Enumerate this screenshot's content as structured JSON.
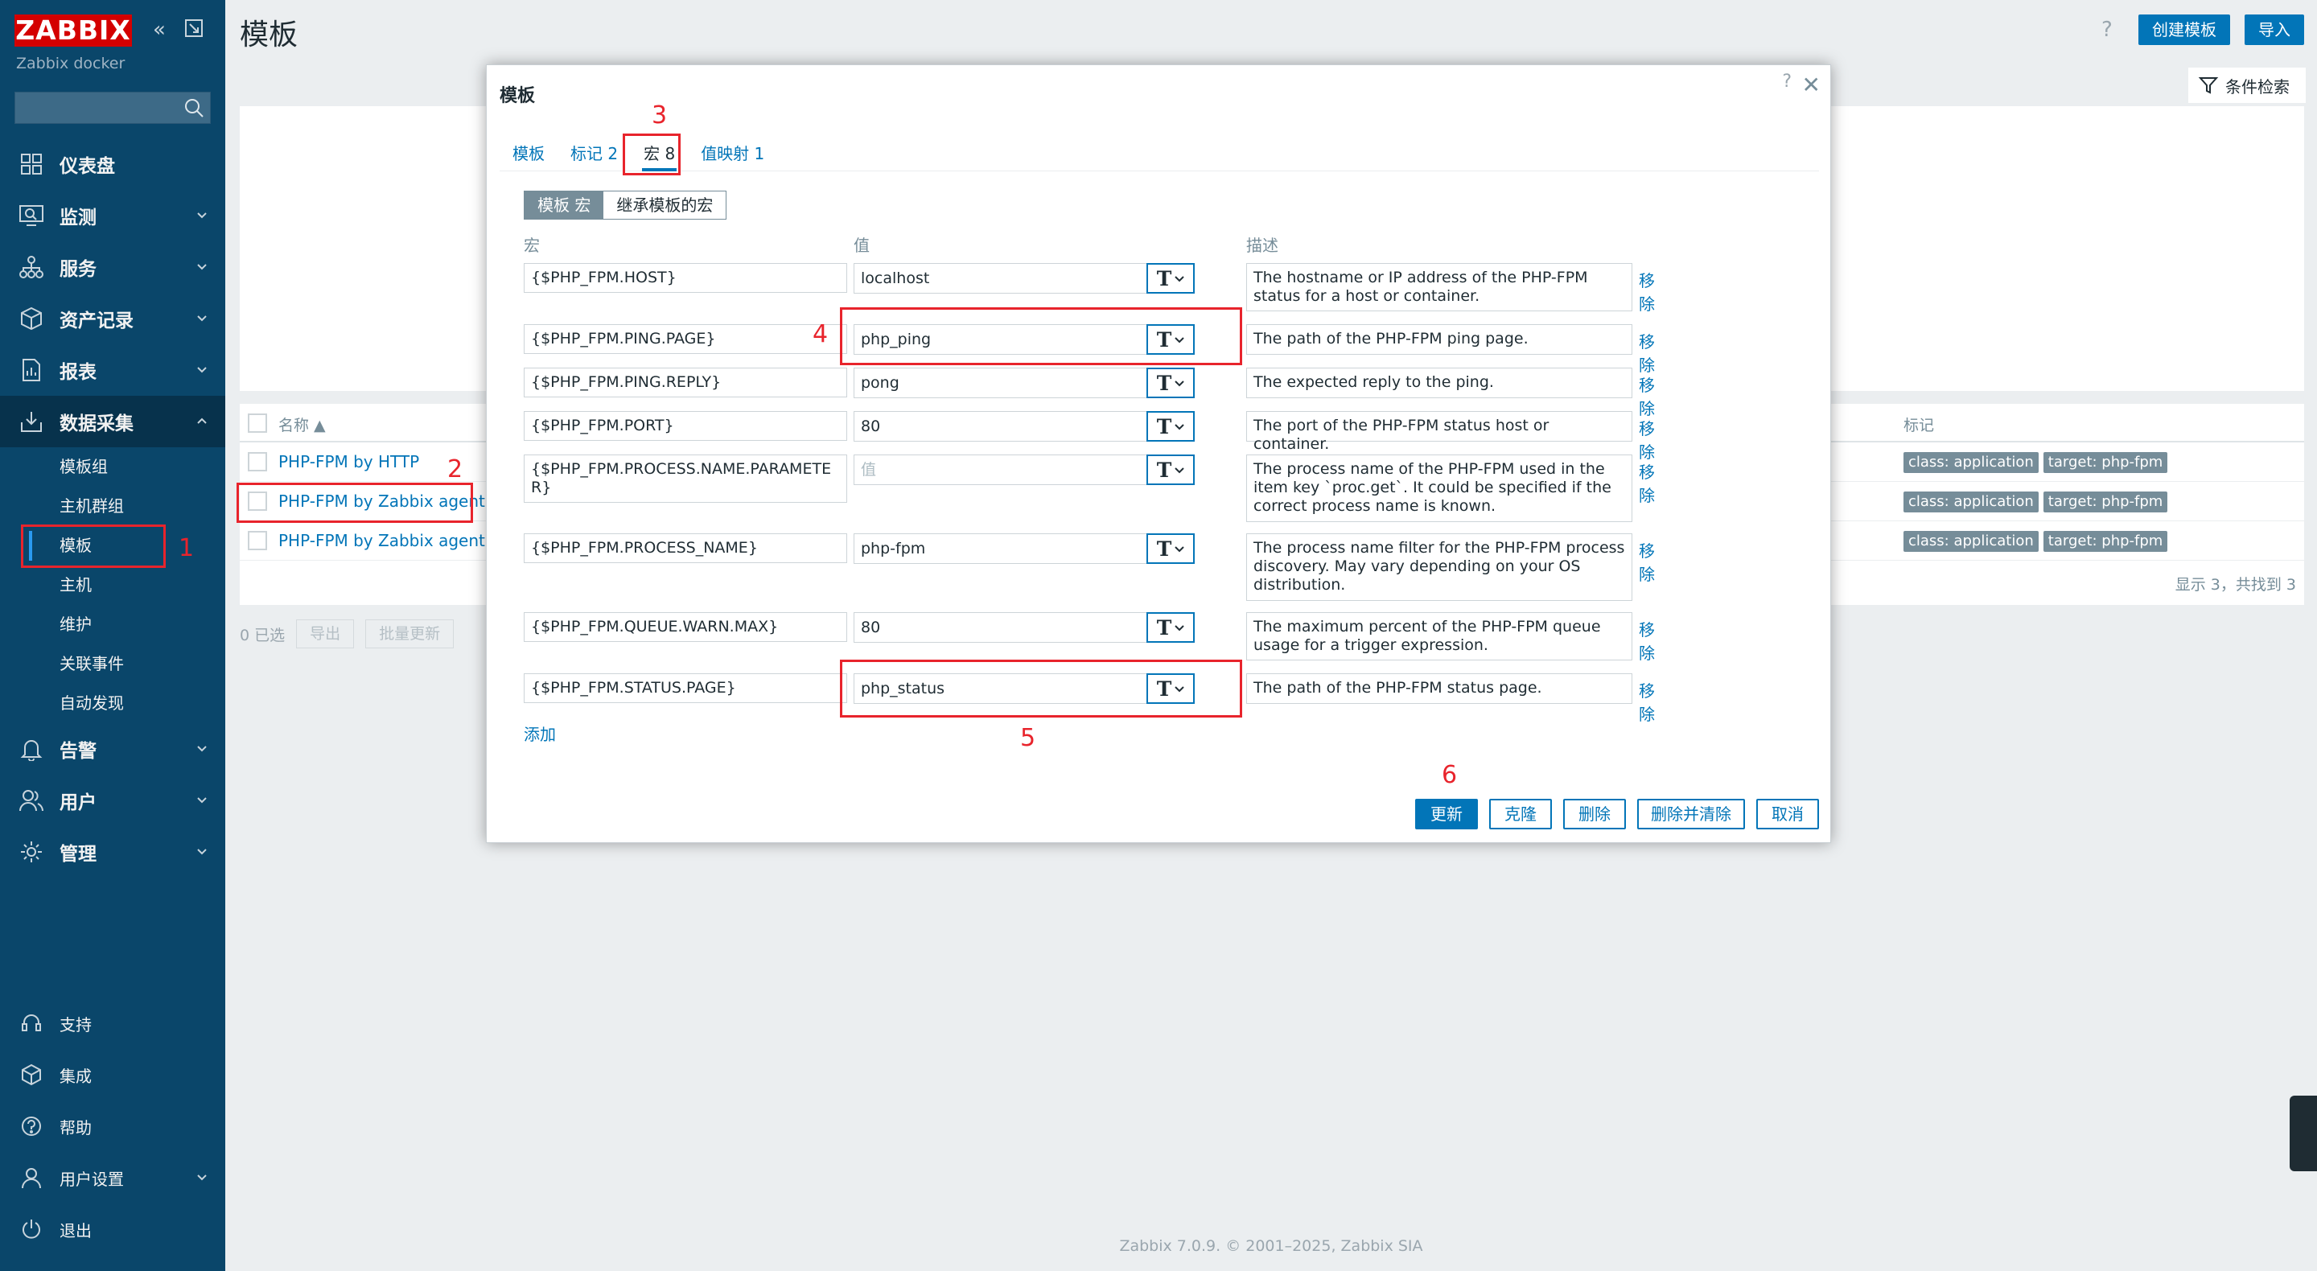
{
  "app": {
    "logo": "ZABBIX",
    "server_name": "Zabbix docker",
    "footer": "Zabbix 7.0.9. © 2001–2025, Zabbix SIA"
  },
  "colors": {
    "sidebar_bg": "#0a466a",
    "accent": "#0275b8",
    "annotation": "#e8242c",
    "logo_bg": "#d40000"
  },
  "sidebar": {
    "search_placeholder": "",
    "menu": [
      {
        "label": "仪表盘",
        "icon": "dashboard-icon"
      },
      {
        "label": "监测",
        "icon": "monitoring-icon"
      },
      {
        "label": "服务",
        "icon": "services-icon"
      },
      {
        "label": "资产记录",
        "icon": "inventory-icon"
      },
      {
        "label": "报表",
        "icon": "reports-icon"
      },
      {
        "label": "数据采集",
        "icon": "data-collection-icon"
      },
      {
        "label": "告警",
        "icon": "alerts-icon"
      },
      {
        "label": "用户",
        "icon": "users-icon"
      },
      {
        "label": "管理",
        "icon": "administration-icon"
      }
    ],
    "submenu": [
      "模板组",
      "主机群组",
      "模板",
      "主机",
      "维护",
      "关联事件",
      "自动发现"
    ],
    "footer_menu": [
      {
        "label": "支持",
        "icon": "support-icon"
      },
      {
        "label": "集成",
        "icon": "integrations-icon"
      },
      {
        "label": "帮助",
        "icon": "help-icon"
      },
      {
        "label": "用户设置",
        "icon": "user-settings-icon"
      },
      {
        "label": "退出",
        "icon": "sign-out-icon"
      }
    ]
  },
  "header": {
    "title": "模板",
    "help": "?",
    "create_button": "创建模板",
    "import_button": "导入",
    "filter_label": "条件检索"
  },
  "table": {
    "col_name": "名称 ▲",
    "col_tags": "标记",
    "rows": [
      {
        "name": "PHP-FPM by HTTP",
        "tags": [
          "class: application",
          "target: php-fpm"
        ]
      },
      {
        "name": "PHP-FPM by Zabbix agent",
        "tags": [
          "class: application",
          "target: php-fpm"
        ]
      },
      {
        "name": "PHP-FPM by Zabbix agent ac",
        "tags": [
          "class: application",
          "target: php-fpm"
        ]
      }
    ],
    "found": "显示 3，共找到 3"
  },
  "bulk": {
    "selected": "0 已选",
    "export": "导出",
    "mass_update": "批量更新"
  },
  "modal": {
    "title": "模板",
    "help": "?",
    "close": "✕",
    "tabs": [
      {
        "label": "模板",
        "count": ""
      },
      {
        "label": "标记",
        "count": "2"
      },
      {
        "label": "宏",
        "count": "8"
      },
      {
        "label": "值映射",
        "count": "1"
      }
    ],
    "segments": [
      "模板 宏",
      "继承模板的宏"
    ],
    "col_macro": "宏",
    "col_value": "值",
    "col_desc": "描述",
    "remove_label": "移除",
    "value_placeholder": "值",
    "macros": [
      {
        "macro": "{$PHP_FPM.HOST}",
        "value": "localhost",
        "desc": "The hostname or IP address of the PHP-FPM status for a host or container."
      },
      {
        "macro": "{$PHP_FPM.PING.PAGE}",
        "value": "php_ping",
        "desc": "The path of the PHP-FPM ping page."
      },
      {
        "macro": "{$PHP_FPM.PING.REPLY}",
        "value": "pong",
        "desc": "The expected reply to the ping."
      },
      {
        "macro": "{$PHP_FPM.PORT}",
        "value": "80",
        "desc": "The port of the PHP-FPM status host or container."
      },
      {
        "macro": "{$PHP_FPM.PROCESS.NAME.PARAMETER}",
        "value": "",
        "desc": "The process name of the PHP-FPM used in the item key `proc.get`. It could be specified if the correct process name is known."
      },
      {
        "macro": "{$PHP_FPM.PROCESS_NAME}",
        "value": "php-fpm",
        "desc": "The process name filter for the PHP-FPM process discovery. May vary depending on your OS distribution."
      },
      {
        "macro": "{$PHP_FPM.QUEUE.WARN.MAX}",
        "value": "80",
        "desc": "The maximum percent of the PHP-FPM queue usage for a trigger expression."
      },
      {
        "macro": "{$PHP_FPM.STATUS.PAGE}",
        "value": "php_status",
        "desc": "The path of the PHP-FPM status page."
      }
    ],
    "add_label": "添加",
    "buttons": {
      "update": "更新",
      "clone": "克隆",
      "delete": "删除",
      "delete_clear": "删除并清除",
      "cancel": "取消"
    }
  },
  "annotations": [
    "1",
    "2",
    "3",
    "4",
    "5",
    "6"
  ]
}
